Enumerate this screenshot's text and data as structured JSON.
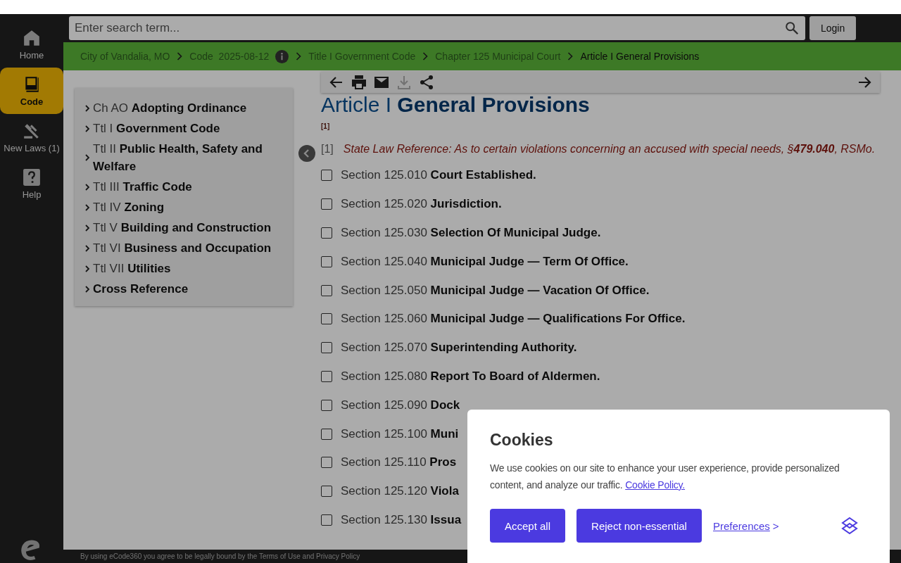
{
  "sidebar": {
    "items": [
      {
        "kind": "home",
        "label": "Home",
        "selected": false
      },
      {
        "kind": "code",
        "label": "Code",
        "selected": true
      },
      {
        "kind": "laws",
        "label": "New Laws (1)",
        "selected": false
      },
      {
        "kind": "help",
        "label": "Help",
        "selected": false
      }
    ]
  },
  "search": {
    "placeholder": "Enter search term..."
  },
  "login_button": "Login",
  "breadcrumb": [
    {
      "label": "City of Vandalia, MO",
      "current": false,
      "info": false
    },
    {
      "label": "Code  2025-08-12",
      "current": false,
      "info": true
    },
    {
      "label": "Title I Government Code",
      "current": false,
      "info": false
    },
    {
      "label": "Chapter 125 Municipal Court",
      "current": false,
      "info": false
    },
    {
      "label": "Article I General Provisions",
      "current": true,
      "info": false
    }
  ],
  "toc": [
    {
      "prefix": "Ch AO",
      "title": "Adopting Ordinance"
    },
    {
      "prefix": "Ttl I",
      "title": "Government Code"
    },
    {
      "prefix": "Ttl II",
      "title": "Public Health, Safety and Welfare"
    },
    {
      "prefix": "Ttl III",
      "title": "Traffic Code"
    },
    {
      "prefix": "Ttl IV",
      "title": "Zoning"
    },
    {
      "prefix": "Ttl V",
      "title": "Building and Construction"
    },
    {
      "prefix": "Ttl VI",
      "title": "Business and Occupation"
    },
    {
      "prefix": "Ttl VII",
      "title": "Utilities"
    },
    {
      "title": "Cross Reference"
    }
  ],
  "toolbar": [
    {
      "kind": "back",
      "disabled": false
    },
    {
      "kind": "print",
      "disabled": false
    },
    {
      "kind": "email",
      "disabled": false
    },
    {
      "kind": "download",
      "disabled": true
    },
    {
      "kind": "share",
      "disabled": false
    },
    {
      "kind": "forward",
      "disabled": false
    }
  ],
  "article": {
    "prefix": "Article I",
    "title": "General Provisions",
    "note_mark": "[1]",
    "footnote": {
      "mark": "[1]",
      "text": "State Law Reference: As to certain violations concerning an accused with special needs, §**479.040**, RSMo."
    }
  },
  "sections": [
    {
      "number": "Section 125.010",
      "title": "Court Established.",
      "checked": false
    },
    {
      "number": "Section 125.020",
      "title": "Jurisdiction.",
      "checked": false
    },
    {
      "number": "Section 125.030",
      "title": "Selection Of Municipal Judge.",
      "checked": false
    },
    {
      "number": "Section 125.040",
      "title": "Municipal Judge — Term Of Office.",
      "checked": false
    },
    {
      "number": "Section 125.050",
      "title": "Municipal Judge — Vacation Of Office.",
      "checked": false
    },
    {
      "number": "Section 125.060",
      "title": "Municipal Judge — Qualifications For Office.",
      "checked": false
    },
    {
      "number": "Section 125.070",
      "title": "Superintending Authority.",
      "checked": false
    },
    {
      "number": "Section 125.080",
      "title": "Report To Board of Aldermen.",
      "checked": false
    },
    {
      "number": "Section 125.090",
      "title": "Dock",
      "checked": false
    },
    {
      "number": "Section 125.100",
      "title": "Muni",
      "checked": false
    },
    {
      "number": "Section 125.110",
      "title": "Pros",
      "checked": false
    },
    {
      "number": "Section 125.120",
      "title": "Viola",
      "checked": false
    },
    {
      "number": "Section 125.130",
      "title": "Issua",
      "checked": false
    }
  ],
  "footer": "By using eCode360 you agree to be legally bound by the Terms of Use and Privacy Policy",
  "cookies": {
    "title": "Cookies",
    "text": "We use cookies on our site to enhance your user experience, provide personalized content, and analyze our traffic.",
    "policy_link": "Cookie Policy.",
    "buttons": [
      "Accept all",
      "Reject non-essential"
    ],
    "preferences_link": "Preferences",
    "preferences_arrow": ">"
  }
}
